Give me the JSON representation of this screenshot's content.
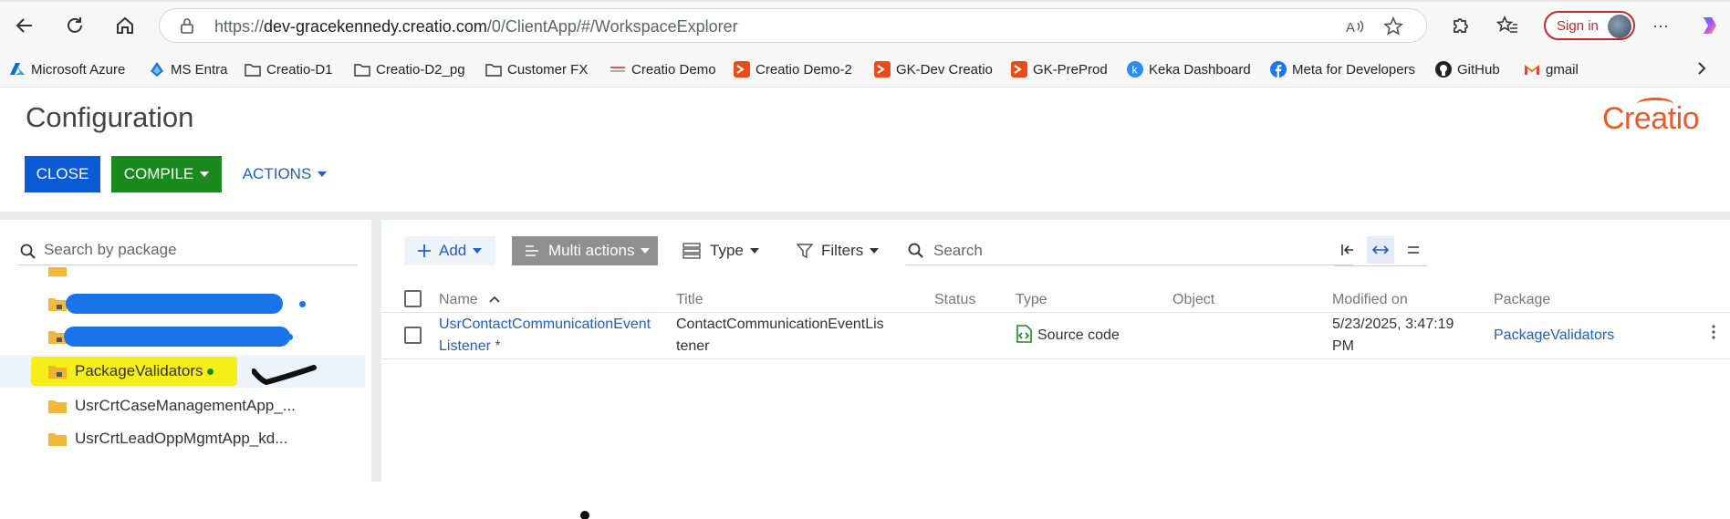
{
  "browser": {
    "url_prefix": "https://",
    "url_host": "dev-gracekennedy.creatio.com",
    "url_path": "/0/ClientApp/#/WorkspaceExplorer",
    "sign_in_label": "Sign in",
    "more_label": "···"
  },
  "favorites": [
    {
      "label": "Microsoft Azure",
      "icon": "azure-icon"
    },
    {
      "label": "MS Entra",
      "icon": "entra-icon"
    },
    {
      "label": "Creatio-D1",
      "icon": "folder-icon"
    },
    {
      "label": "Creatio-D2_pg",
      "icon": "folder-icon"
    },
    {
      "label": "Customer FX",
      "icon": "folder-icon"
    },
    {
      "label": "Creatio Demo",
      "icon": "creatio-icon"
    },
    {
      "label": "Creatio Demo-2",
      "icon": "creatio-red-icon"
    },
    {
      "label": "GK-Dev Creatio",
      "icon": "creatio-red-icon"
    },
    {
      "label": "GK-PreProd",
      "icon": "creatio-red-icon"
    },
    {
      "label": "Keka Dashboard",
      "icon": "keka-icon"
    },
    {
      "label": "Meta for Developers",
      "icon": "facebook-icon"
    },
    {
      "label": "GitHub",
      "icon": "github-icon"
    },
    {
      "label": "gmail",
      "icon": "gmail-icon"
    }
  ],
  "page": {
    "title": "Configuration",
    "logo": "Creatio",
    "close_label": "CLOSE",
    "compile_label": "COMPILE",
    "actions_label": "ACTIONS"
  },
  "left": {
    "search_placeholder": "Search by package",
    "items": [
      {
        "label": "",
        "redacted": true
      },
      {
        "label": "",
        "redacted": true
      },
      {
        "label": "PackageValidators",
        "selected": true
      },
      {
        "label": "UsrCrtCaseManagementApp_..."
      },
      {
        "label": "UsrCrtLeadOppMgmtApp_kd..."
      }
    ]
  },
  "toolbar": {
    "add_label": "Add",
    "multi_actions_label": "Multi actions",
    "type_label": "Type",
    "filters_label": "Filters",
    "search_placeholder": "Search"
  },
  "grid": {
    "columns": [
      "Name",
      "Title",
      "Status",
      "Type",
      "Object",
      "Modified on",
      "Package"
    ],
    "rows": [
      {
        "name_line1": "UsrContactCommunicationEvent",
        "name_line2": "Listener *",
        "title_line1": "ContactCommunicationEventLis",
        "title_line2": "tener",
        "status": "",
        "type": "Source code",
        "object": "",
        "modified_line1": "5/23/2025, 3:47:19",
        "modified_line2": "PM",
        "package": "PackageValidators"
      }
    ]
  },
  "colors": {
    "primary_blue": "#0b5bd6",
    "compile_green": "#1a8a1e",
    "logo_orange": "#ea5a2a",
    "link_blue": "#1f5fc2"
  }
}
